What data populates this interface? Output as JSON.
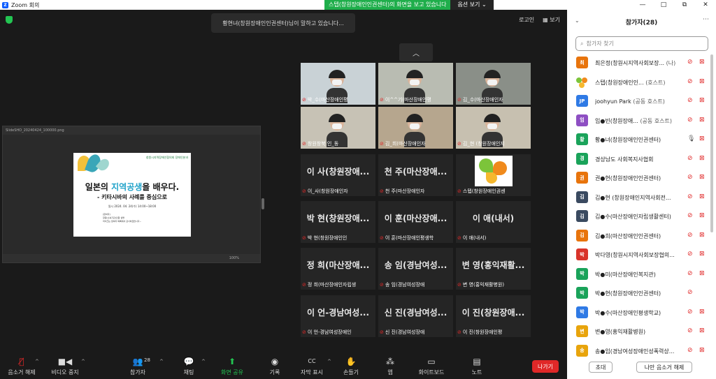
{
  "window": {
    "title": "Zoom 회의",
    "controls": [
      "—",
      "□",
      "⧉",
      "✕"
    ]
  },
  "share_banner": {
    "text": "스텝(창원장애인인권센터)의 화면을 보고 있습니다",
    "options_label": "옵션 보기"
  },
  "speaking_label": "황현녀(창원장애인인권센터)님이 말하고 있습니다...",
  "top_right": {
    "logo_label": "로고인",
    "view_label": "보기"
  },
  "slide": {
    "filename": "SlideSHO_20240424_100000.png",
    "org": "창원시지역장애인협의회 장애인분과",
    "title_pre": "일본의 ",
    "title_highlight": "지역공생",
    "title_post": "을 배우다.",
    "subtitle": "- 키타시바의 사례를 중심으로",
    "datetime": "일시 2024. 04. 24(수) 14:00~18:00",
    "details": [
      "[참여자]",
      "창원(소속기관)인원 설명",
      "마이크는 참여자 목록에서 감사하겠습니다~"
    ],
    "zoom": "100%"
  },
  "gallery": [
    {
      "type": "video",
      "caption": "박_수(마산장애인평"
    },
    {
      "type": "video",
      "caption": "이^^기(마산장애인평"
    },
    {
      "type": "video",
      "caption": "김_수(마산장애인자"
    },
    {
      "type": "video",
      "caption": "창원창북 인_동"
    },
    {
      "type": "video",
      "caption": "김_희(마산장애인자"
    },
    {
      "type": "video",
      "caption": "김_현 (창원장애인지"
    },
    {
      "type": "name",
      "bigname": "이   사(창원장애...",
      "caption": "이_사(창원장애인자"
    },
    {
      "type": "name",
      "bigname": "천   주(마산장애...",
      "caption": "천   주(마산장애인자"
    },
    {
      "type": "logo",
      "caption": "스텝(창원장애인권센"
    },
    {
      "type": "name",
      "bigname": "박   현(창원장애...",
      "caption": "박   현(창원장애인인"
    },
    {
      "type": "name",
      "bigname": "이   훈(마산장애...",
      "caption": "이   훈(마산장애인평생학"
    },
    {
      "type": "name",
      "bigname": "이   애(내서)",
      "caption": "이   애(내서)"
    },
    {
      "type": "name",
      "bigname": "정   희(마산장애...",
      "caption": "정   희(마산장애인자립생"
    },
    {
      "type": "name",
      "bigname": "송   임(경남여성...",
      "caption": "송   임(경남여성장애"
    },
    {
      "type": "name",
      "bigname": "변   영(홍익재활...",
      "caption": "변   영(홍익재활병원)"
    },
    {
      "type": "name",
      "bigname": "이   언-경남여성...",
      "caption": "이   언-경남여성장애인"
    },
    {
      "type": "name",
      "bigname": "신   진(경남여성...",
      "caption": "신   진(경남여성장애"
    },
    {
      "type": "name",
      "bigname": "이   진(창원장애...",
      "caption": "이   진(창원장애인평"
    }
  ],
  "toolbar": {
    "mute_label": "음소거 해제",
    "video_label": "비디오 중지",
    "participants_label": "참가자",
    "participants_count": "28",
    "chat_label": "채팅",
    "share_label": "화면 공유",
    "record_label": "기록",
    "caption_label": "자막 표시",
    "caption_icon": "CC",
    "raise_label": "손들기",
    "apps_label": "앱",
    "whiteboard_label": "화이트보드",
    "notes_label": "노트",
    "leave_label": "나가기"
  },
  "panel": {
    "title": "참가자(28)",
    "search_placeholder": "참가자 찾기",
    "invite_label": "초대",
    "unmute_me_label": "나만 음소거 해제"
  },
  "participants": [
    {
      "initial": "최",
      "color": "#e8740c",
      "name": "최은정(창원시지역사회보장...",
      "tag": "(나)",
      "mic": "muted",
      "cam": "off"
    },
    {
      "initial": "",
      "color": "#ffffff",
      "logo": true,
      "name": "스텝(창원장애인인...",
      "tag": "(호스트)",
      "mic": "muted",
      "cam": "off"
    },
    {
      "initial": "JP",
      "color": "#2f7ae5",
      "name": "joohyun Park",
      "tag": "(공동 호스트)",
      "mic": "muted",
      "cam": "off"
    },
    {
      "initial": "임",
      "color": "#8e4fc3",
      "name": "임●빈(창원장애...",
      "tag": "(공동 호스트)",
      "mic": "muted",
      "cam": "off"
    },
    {
      "initial": "황",
      "color": "#1aa35a",
      "name": "황●녀(창원장애인인권센터)",
      "tag": "",
      "mic": "active",
      "cam": "off"
    },
    {
      "initial": "경",
      "color": "#1aa35a",
      "name": "경상남도 사회복지사협회",
      "tag": "",
      "mic": "muted",
      "cam": "off"
    },
    {
      "initial": "권",
      "color": "#e8740c",
      "name": "권●현(창원장애인인권센터)",
      "tag": "",
      "mic": "muted",
      "cam": "off"
    },
    {
      "initial": "김",
      "color": "#3a4a60",
      "name": "김●현 (창원장애인지역사회전...",
      "tag": "",
      "mic": "muted",
      "cam": "off"
    },
    {
      "initial": "김",
      "color": "#3a4a60",
      "name": "김●수(마산장애인자립생활센터)",
      "tag": "",
      "mic": "muted",
      "cam": "off"
    },
    {
      "initial": "김",
      "color": "#e8740c",
      "name": "김●희(마산장애인인권센터)",
      "tag": "",
      "mic": "muted",
      "cam": "off"
    },
    {
      "initial": "박",
      "color": "#d9342b",
      "name": "박다영(창원시지역사회보장협의...",
      "tag": "",
      "mic": "muted",
      "cam": "off"
    },
    {
      "initial": "박",
      "color": "#1aa35a",
      "name": "박●미(마산장애인복지관)",
      "tag": "",
      "mic": "muted",
      "cam": "off"
    },
    {
      "initial": "박",
      "color": "#1aa35a",
      "name": "박●현(창원장애인인권센터)",
      "tag": "",
      "mic": "muted",
      "cam": ""
    },
    {
      "initial": "박",
      "color": "#2f7ae5",
      "name": "박●수(마산장애인평생학교)",
      "tag": "",
      "mic": "muted",
      "cam": "off"
    },
    {
      "initial": "변",
      "color": "#e8a40c",
      "name": "변●영(홍익재활병원)",
      "tag": "",
      "mic": "muted",
      "cam": "off"
    },
    {
      "initial": "송",
      "color": "#e8a40c",
      "name": "송●임(경남여성장애인성폭력상...",
      "tag": "",
      "mic": "muted",
      "cam": "off"
    }
  ]
}
